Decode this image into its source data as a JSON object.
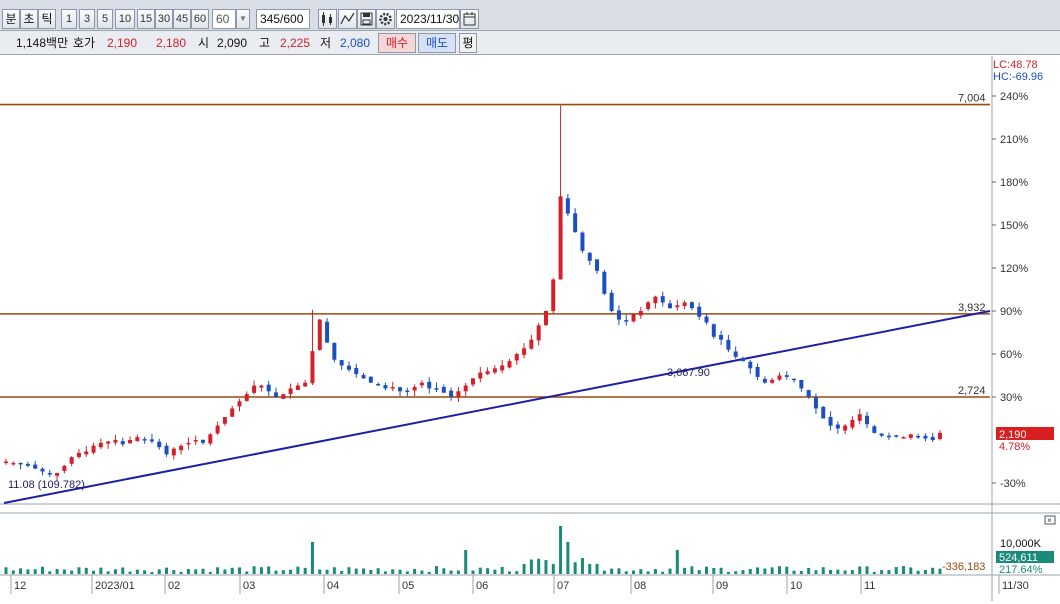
{
  "toolbar": {
    "period_buttons": [
      "분",
      "초",
      "틱"
    ],
    "interval_buttons": [
      "1",
      "3",
      "5",
      "10",
      "15",
      "30",
      "45",
      "60"
    ],
    "interval_select": "60",
    "count_value": "345",
    "count_total": "/600",
    "date_value": "2023/11/30"
  },
  "quote": {
    "volume_amount": "1,148백만",
    "bid_label": "호가",
    "bid1": "2,190",
    "bid2": "2,180",
    "open_label": "시",
    "open": "2,090",
    "high_label": "고",
    "high": "2,225",
    "low_label": "저",
    "low": "2,080",
    "buy_label": "매수",
    "sell_label": "매도",
    "extra_label": "평"
  },
  "indicators": {
    "lc": "LC:48.78",
    "hc": "HC:-69.96"
  },
  "colors": {
    "up": "#d3202a",
    "down": "#1c4fbf",
    "level_line": "#9c4a12",
    "trendline": "#1e1ea6",
    "volume": "#1a8a7a",
    "price_badge": "#d91f1f",
    "volume_badge": "#1a8a7a"
  },
  "chart_data": {
    "type": "candlestick",
    "x_labels": [
      "12",
      "2023/01",
      "02",
      "03",
      "04",
      "05",
      "06",
      "07",
      "08",
      "09",
      "10",
      "11",
      "11/30"
    ],
    "y_axis_percent": [
      240,
      210,
      180,
      150,
      120,
      90,
      60,
      30,
      -30
    ],
    "y_unit_suffix": "%",
    "base_price": 2090,
    "levels": [
      {
        "label": "7,004",
        "pct": 234
      },
      {
        "label": "3,932",
        "pct": 88
      },
      {
        "label": "2,724",
        "pct": 30
      }
    ],
    "trendline_labels": {
      "start": "11.08 (109.782)",
      "mid": "3,667.90"
    },
    "last_price": "2,190",
    "last_change": "4.78%",
    "volume_axis": {
      "top_label": "10,000K",
      "current": "524,611",
      "current_pct": "217.64%",
      "baseline_label": "-336,183"
    },
    "close_pct_path": [
      -15,
      -16,
      -17,
      -18,
      -20,
      -22,
      -24,
      -23,
      -18,
      -12,
      -9,
      -8,
      -4,
      -2,
      -1,
      0,
      -3,
      0,
      2,
      0,
      -1,
      -5,
      -10,
      -6,
      -4,
      -2,
      0,
      -2,
      4,
      10,
      16,
      22,
      27,
      32,
      38,
      38,
      34,
      30,
      32,
      36,
      38,
      40,
      62,
      84,
      68,
      56,
      52,
      49,
      46,
      43,
      40,
      38,
      36,
      37,
      34,
      34,
      37,
      40,
      36,
      36,
      33,
      30,
      34,
      38,
      43,
      47,
      48,
      50,
      52,
      55,
      60,
      64,
      70,
      80,
      90,
      112,
      170,
      158,
      145,
      132,
      125,
      118,
      102,
      90,
      84,
      83,
      88,
      90,
      96,
      100,
      96,
      92,
      94,
      96,
      92,
      86,
      82,
      72,
      70,
      63,
      58,
      55,
      50,
      44,
      40,
      42,
      45,
      44,
      42,
      36,
      30,
      22,
      15,
      10,
      8,
      10,
      14,
      18,
      11,
      5,
      3,
      2,
      3,
      2,
      4,
      2,
      1,
      0,
      5
    ]
  }
}
